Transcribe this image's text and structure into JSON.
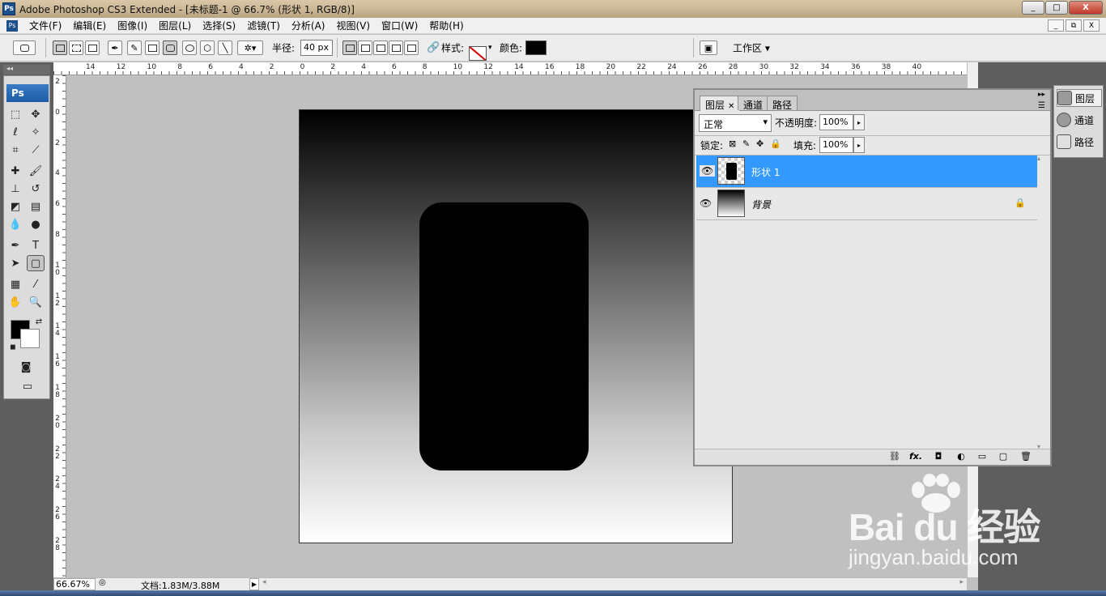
{
  "window": {
    "title": "Adobe Photoshop CS3 Extended - [未标题-1 @ 66.7% (形状 1, RGB/8)]",
    "logo": "Ps",
    "buttons": [
      "_",
      "□",
      "X"
    ]
  },
  "menubar": {
    "icon": "Ps",
    "items": [
      "文件(F)",
      "编辑(E)",
      "图像(I)",
      "图层(L)",
      "选择(S)",
      "滤镜(T)",
      "分析(A)",
      "视图(V)",
      "窗口(W)",
      "帮助(H)"
    ],
    "doc_buttons": [
      "_",
      "⧉",
      "X"
    ]
  },
  "options": {
    "radius_label": "半径:",
    "radius_value": "40 px",
    "style_label": "样式:",
    "color_label": "颜色:",
    "color_value": "#000000",
    "workspace_label": "工作区 ▾"
  },
  "toolbox": {
    "brand": "Ps",
    "foreground": "#000000",
    "background": "#ffffff"
  },
  "ruler": {
    "top_ticks": [
      "14",
      "12",
      "10",
      "8",
      "6",
      "4",
      "2",
      "0",
      "2",
      "4",
      "6",
      "8",
      "10",
      "12",
      "14",
      "16",
      "18",
      "20",
      "22",
      "24",
      "26",
      "28",
      "30",
      "32",
      "34",
      "36",
      "38",
      "40"
    ],
    "left_ticks": [
      "2",
      "0",
      "2",
      "4",
      "6",
      "8",
      "1 0",
      "1 2",
      "1 4",
      "1 6",
      "1 8",
      "2 0",
      "2 2",
      "2 4",
      "2 6",
      "2 8"
    ]
  },
  "layers_panel": {
    "tabs": [
      "图层",
      "通道",
      "路径"
    ],
    "blend_mode": "正常",
    "opacity_label": "不透明度:",
    "opacity_value": "100%",
    "lock_label": "锁定:",
    "fill_label": "填充:",
    "fill_value": "100%",
    "layers": [
      {
        "name": "形状 1",
        "selected": true
      },
      {
        "name": "背景",
        "selected": false,
        "locked": true
      }
    ],
    "bottom_buttons": [
      "link-icon",
      "fx",
      "mask-icon",
      "adjust-icon",
      "folder-icon",
      "new-layer-icon",
      "trash-icon"
    ],
    "fx_label": "fx."
  },
  "dock": {
    "items": [
      "图层",
      "通道",
      "路径"
    ]
  },
  "status": {
    "zoom": "66.67%",
    "doc_info": "文档:1.83M/3.88M"
  },
  "watermark": {
    "brand": "Bai du 经验",
    "url": "jingyan.baidu.com"
  },
  "colors": {
    "selection_blue": "#3399ff",
    "accent": "#1c4f8c"
  }
}
